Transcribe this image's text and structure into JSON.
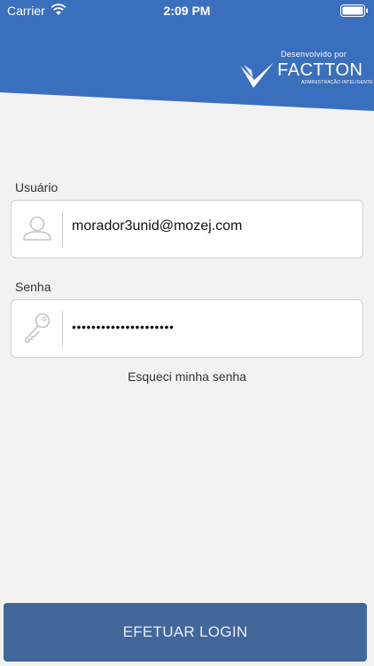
{
  "status_bar": {
    "carrier": "Carrier",
    "time": "2:09 PM"
  },
  "brand": {
    "tagline": "Desenvolvido por",
    "name": "FACTTON",
    "subtitle": "ADMINISTRAÇÃO INTELIGENTE"
  },
  "form": {
    "username": {
      "label": "Usuário",
      "value": "morador3unid@mozej.com",
      "icon": "user-icon"
    },
    "password": {
      "label": "Senha",
      "value": "•••••••••••••••••••••",
      "icon": "key-icon"
    },
    "forgot_label": "Esqueci minha senha"
  },
  "login_button": {
    "label": "EFETUAR LOGIN"
  },
  "colors": {
    "header_blue": "#3a6fbd",
    "background": "#f2f2f2",
    "button": "#42679a",
    "button_text": "#e8eef7"
  }
}
